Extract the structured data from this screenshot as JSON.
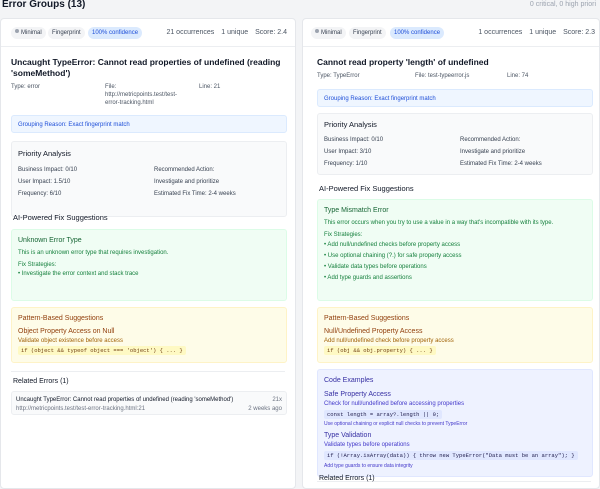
{
  "header": {
    "title": "Error Groups (13)",
    "summary": "0 critical, 0 high priori"
  },
  "groups": [
    {
      "chips": {
        "severity": "Minimal",
        "method": "Fingerprint",
        "confidence": "100% confidence"
      },
      "stats": {
        "occurrences": "21 occurrences",
        "unique": "1 unique",
        "score": "Score: 2.4"
      },
      "title_line1": "Uncaught TypeError: Cannot read properties of undefined (reading",
      "title_line2": "'someMethod')",
      "meta": {
        "type": "Type: error",
        "file_label": "File:",
        "file_line1": "http://metricpoints.test/test-",
        "file_line2": "error-tracking.html",
        "line": "Line: 21"
      },
      "grouping_reason": "Grouping Reason: Exact fingerprint match",
      "priority": {
        "heading": "Priority Analysis",
        "business_impact": "Business Impact: 0/10",
        "user_impact": "User Impact: 1.5/10",
        "frequency": "Frequency: 6/10",
        "recommended_action_label": "Recommended Action:",
        "recommended_action": "Investigate and prioritize",
        "estimated_fix": "Estimated Fix Time: 2-4 weeks"
      },
      "ai_heading": "AI-Powered Fix Suggestions",
      "ai_box": {
        "title": "Unknown Error Type",
        "description": "This is an unknown error type that requires investigation.",
        "strategies_label": "Fix Strategies:",
        "strategies": [
          "• Investigate the error context and stack trace"
        ]
      },
      "pattern_box": {
        "heading": "Pattern-Based Suggestions",
        "title": "Object Property Access on Null",
        "description": "Validate object existence before access",
        "code": "if (object && typeof object === 'object') { ... }"
      },
      "related": {
        "heading": "Related Errors (1)",
        "items": [
          {
            "message": "Uncaught TypeError: Cannot read properties of undefined (reading 'someMethod')",
            "url": "http://metricpoints.test/test-error-tracking.html:21",
            "count": "21x",
            "ago": "2 weeks ago"
          }
        ]
      }
    },
    {
      "chips": {
        "severity": "Minimal",
        "method": "Fingerprint",
        "confidence": "100% confidence"
      },
      "stats": {
        "occurrences": "1 occurrences",
        "unique": "1 unique",
        "score": "Score: 2.3"
      },
      "title_line1": "Cannot read property 'length' of undefined",
      "meta": {
        "type": "Type: TypeError",
        "file": "File: test-typeerror.js",
        "line": "Line: 74"
      },
      "grouping_reason": "Grouping Reason: Exact fingerprint match",
      "priority": {
        "heading": "Priority Analysis",
        "business_impact": "Business Impact: 0/10",
        "user_impact": "User Impact: 3/10",
        "frequency": "Frequency: 1/10",
        "recommended_action_label": "Recommended Action:",
        "recommended_action": "Investigate and prioritize",
        "estimated_fix": "Estimated Fix Time: 2-4 weeks"
      },
      "ai_heading": "AI-Powered Fix Suggestions",
      "ai_box": {
        "title": "Type Mismatch Error",
        "description": "This error occurs when you try to use a value in a way that's incompatible with its type.",
        "strategies_label": "Fix Strategies:",
        "strategies": [
          "• Add null/undefined checks before property access",
          "• Use optional chaining (?.) for safe property access",
          "• Validate data types before operations",
          "• Add type guards and assertions"
        ]
      },
      "pattern_box": {
        "heading": "Pattern-Based Suggestions",
        "title": "Null/Undefined Property Access",
        "description": "Add null/undefined check before property access",
        "code": "if (obj && obj.property) { ... }"
      },
      "code_examples": {
        "heading": "Code Examples",
        "examples": [
          {
            "title": "Safe Property Access",
            "description": "Check for null/undefined before accessing properties",
            "code": "const length = array?.length || 0;",
            "note": "Use optional chaining or explicit null checks to prevent TypeError"
          },
          {
            "title": "Type Validation",
            "description": "Validate types before operations",
            "code": "if (!Array.isArray(data)) { throw new TypeError(\"Data must be an array\"); }",
            "note": "Add type guards to ensure data integrity"
          }
        ]
      },
      "related": {
        "heading": "Related Errors (1)"
      }
    }
  ]
}
